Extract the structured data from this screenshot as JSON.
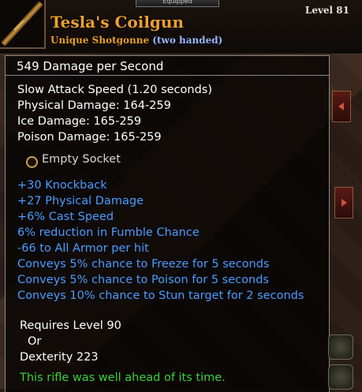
{
  "tooltip": {
    "equipped_label": "Equipped",
    "title": "Tesla's Coilgun",
    "rarity_type": "Unique Shotgonne",
    "handedness": "(two handed)",
    "level": "Level 81",
    "dps": "549  Damage per Second",
    "base_stats": [
      "Slow Attack Speed (1.20 seconds)",
      "Physical Damage: 164-259",
      "Ice Damage: 165-259",
      "Poison Damage: 165-259"
    ],
    "socket": "Empty Socket",
    "magic_stats": [
      "+30 Knockback",
      "+27 Physical Damage",
      "+6% Cast Speed",
      "6% reduction in Fumble Chance",
      "-66 to All Armor per hit",
      "Conveys 5% chance to Freeze for 5 seconds",
      "Conveys 5% chance to Poison for 5 seconds",
      "Conveys 10% chance to Stun target for 2 seconds"
    ],
    "requirements": [
      "Requires Level 90",
      "Or",
      "Dexterity 223"
    ],
    "flavor_text": "This rifle was well ahead of its time."
  },
  "colors": {
    "title": "#f0a030",
    "magic": "#4a9cff",
    "flavor": "#3ad13a"
  },
  "icons": [
    "shotgonne-icon",
    "socket-icon",
    "scroll-left-icon",
    "scroll-right-icon",
    "helmet-icon"
  ]
}
